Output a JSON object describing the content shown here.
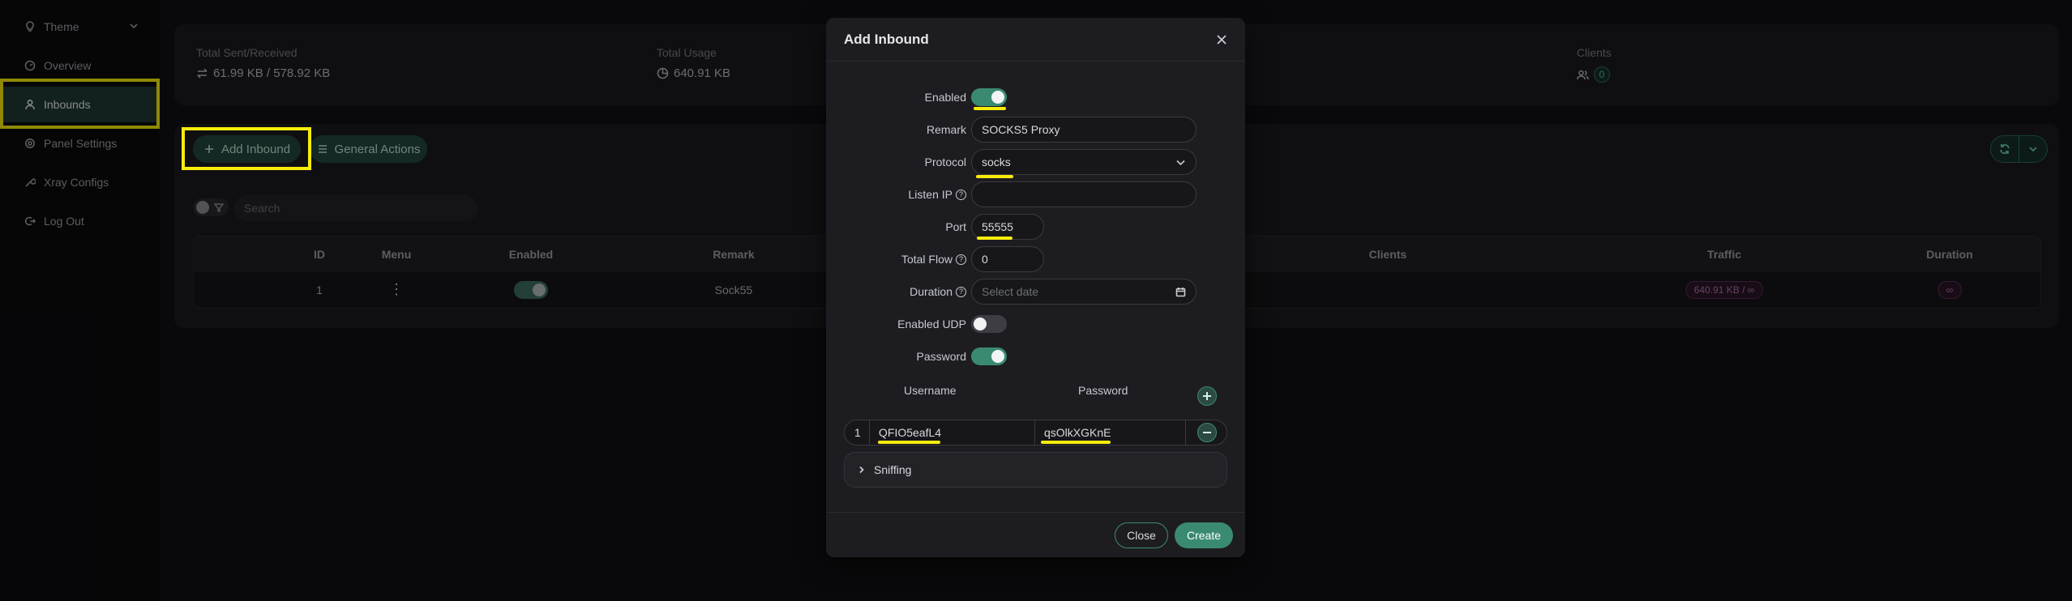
{
  "sidebar": {
    "items": [
      {
        "label": "Theme",
        "icon": "bulb-icon"
      },
      {
        "label": "Overview",
        "icon": "dashboard-icon"
      },
      {
        "label": "Inbounds",
        "icon": "user-icon"
      },
      {
        "label": "Panel Settings",
        "icon": "gear-icon"
      },
      {
        "label": "Xray Configs",
        "icon": "wrench-icon"
      },
      {
        "label": "Log Out",
        "icon": "logout-icon"
      }
    ],
    "active": "Inbounds"
  },
  "stats": {
    "sent_label": "Total Sent/Received",
    "sent_value": "61.99 KB / 578.92 KB",
    "usage_label": "Total Usage",
    "usage_value": "640.91 KB",
    "clients_label": "Clients",
    "clients_value": "0"
  },
  "toolbar": {
    "add_inbound": "Add Inbound",
    "general_actions": "General Actions",
    "search_placeholder": "Search"
  },
  "table": {
    "headers": [
      "ID",
      "Menu",
      "Enabled",
      "Remark",
      "Clients",
      "Traffic",
      "Duration"
    ],
    "row": {
      "id": "1",
      "remark": "Sock55",
      "traffic": "640.91 KB / ∞",
      "duration": "∞"
    }
  },
  "modal": {
    "title": "Add Inbound",
    "enabled_label": "Enabled",
    "remark_label": "Remark",
    "remark_value": "SOCKS5 Proxy",
    "protocol_label": "Protocol",
    "protocol_value": "socks",
    "listen_ip_label": "Listen IP",
    "listen_ip_value": "",
    "port_label": "Port",
    "port_value": "55555",
    "total_flow_label": "Total Flow",
    "total_flow_value": "0",
    "duration_label": "Duration",
    "duration_placeholder": "Select date",
    "udp_label": "Enabled UDP",
    "password_label": "Password",
    "accounts": {
      "username_header": "Username",
      "password_header": "Password",
      "rows": [
        {
          "index": "1",
          "username": "QFIO5eafL4",
          "password": "qsOlkXGKnE"
        }
      ]
    },
    "sniffing_label": "Sniffing",
    "close_label": "Close",
    "create_label": "Create"
  },
  "colors": {
    "accent": "#3a8a72",
    "highlight": "#f7ec0b"
  }
}
